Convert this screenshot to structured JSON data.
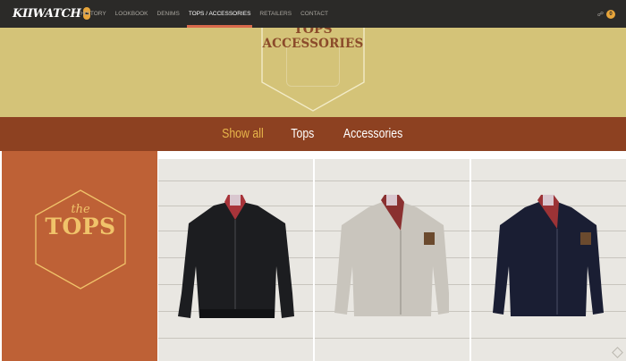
{
  "brand": {
    "logo_text": "KIIWATCH"
  },
  "nav": {
    "items": [
      {
        "label": "HISTORY"
      },
      {
        "label": "LOOKBOOK"
      },
      {
        "label": "DENIMS"
      },
      {
        "label": "TOPS / ACCESSORIES"
      },
      {
        "label": "RETAILERS"
      },
      {
        "label": "CONTACT"
      }
    ],
    "active_index": 3
  },
  "cart": {
    "icon": "cart-icon",
    "count": "0"
  },
  "hero": {
    "title_line1": "TOPS",
    "title_line2": "ACCESSORIES"
  },
  "filters": {
    "items": [
      {
        "label": "Show all",
        "active": true
      },
      {
        "label": "Tops",
        "active": false
      },
      {
        "label": "Accessories",
        "active": false
      }
    ]
  },
  "category": {
    "prefix": "the",
    "title": "TOPS"
  },
  "products": [
    {
      "name": "black harrington jacket",
      "color": "#1c1d20",
      "lining": "#a8343a"
    },
    {
      "name": "stone biker jacket",
      "color": "#c9c5bd",
      "lining": "#8a3030"
    },
    {
      "name": "navy biker jacket",
      "color": "#1a1e33",
      "lining": "#9c3336"
    }
  ],
  "colors": {
    "topbar": "#2b2a28",
    "hero": "#d4c378",
    "filterbar": "#8d4121",
    "accent": "#e8b64b",
    "brand_tile": "#be6136"
  }
}
